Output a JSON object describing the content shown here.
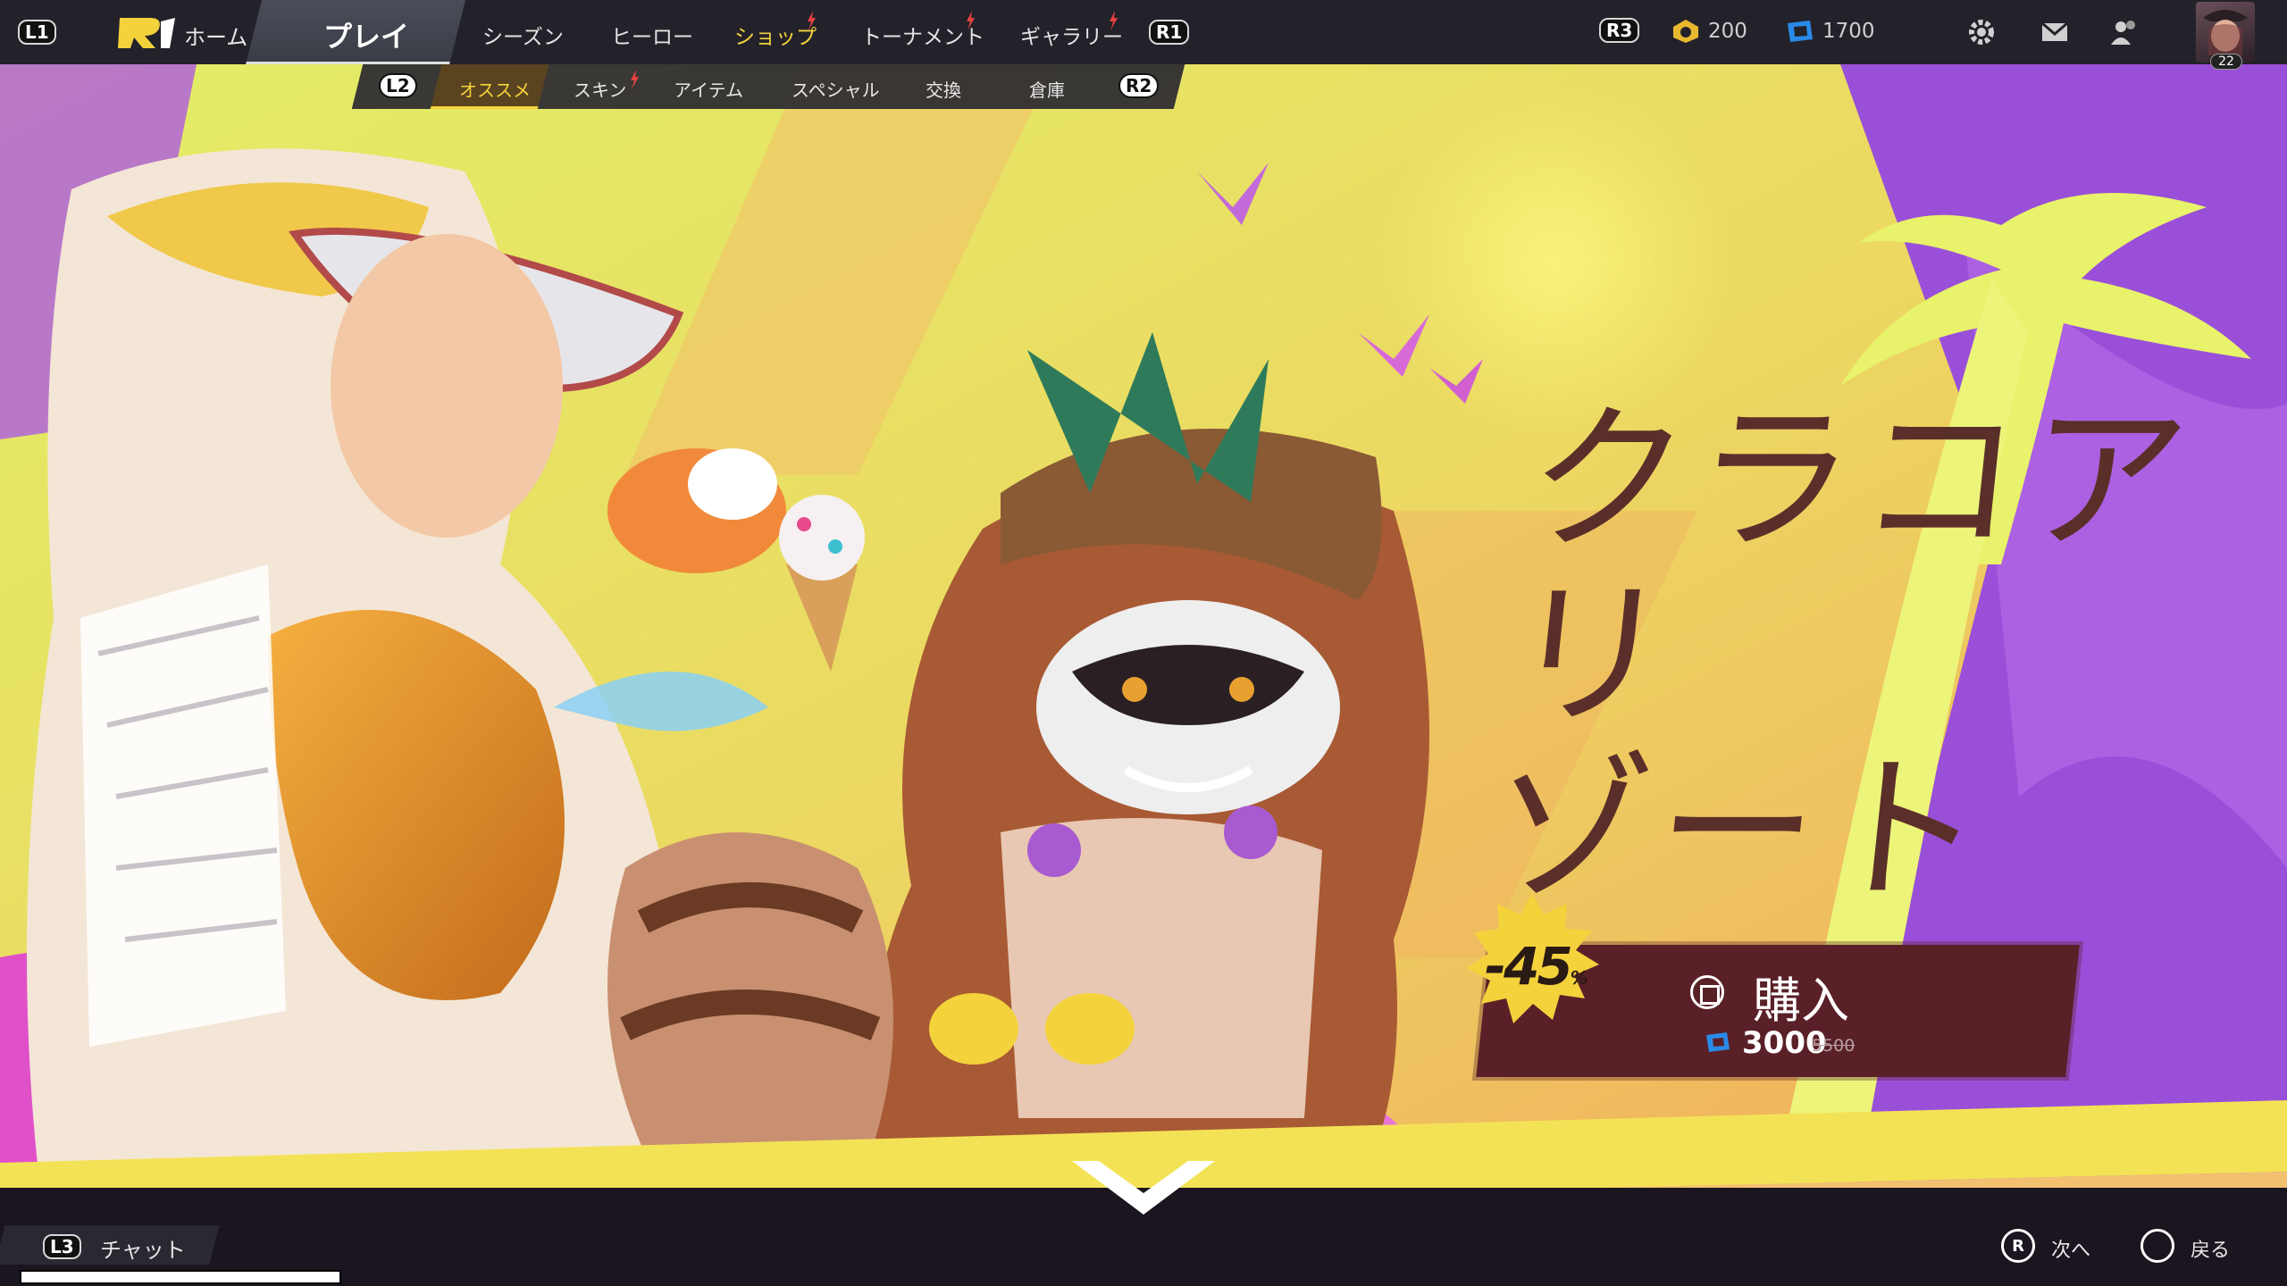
{
  "nav": {
    "l1": "L1",
    "home": "ホーム",
    "play": "プレイ",
    "items": [
      "シーズン",
      "ヒーロー",
      "ショップ",
      "トーナメント",
      "ギャラリー"
    ],
    "r1": "R1",
    "r3": "R3"
  },
  "currency": {
    "gold": "200",
    "lattice": "1700"
  },
  "profile": {
    "level": "22"
  },
  "subnav": {
    "l2": "L2",
    "items": [
      "オススメ",
      "スキン",
      "アイテム",
      "スペシャル",
      "交換",
      "倉庫"
    ],
    "active": "オススメ",
    "r2": "R2"
  },
  "bundle": {
    "title_line1": "クラコアリ",
    "title_line2": "ゾート",
    "discount": "-45",
    "discount_unit": "%",
    "buy_label": "購入",
    "price": "3000",
    "old_price": "5500"
  },
  "bottom": {
    "l3": "L3",
    "chat": "チャット",
    "next_key": "R",
    "next": "次へ",
    "back": "戻る"
  },
  "colors": {
    "nav_bg": "#23222a",
    "accent_yellow": "#f4d23c",
    "title_brown": "#5b2f29",
    "buy_panel": "#5a2028",
    "bg_lime": "#d7ec5a",
    "bg_purple": "#9a4fd8",
    "bg_orange": "#f0a85a"
  }
}
